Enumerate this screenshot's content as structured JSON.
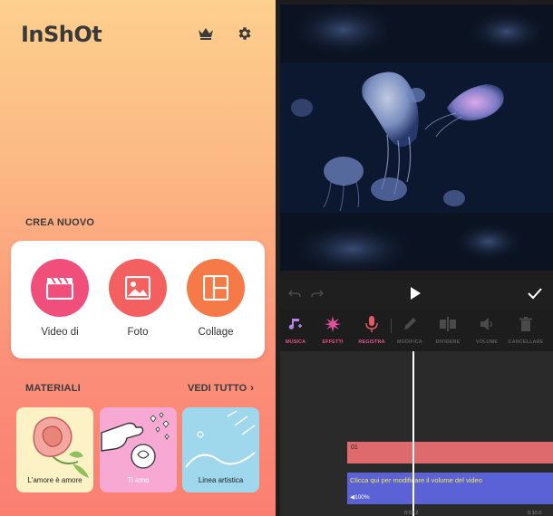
{
  "home": {
    "logo": "InShOt",
    "icons": {
      "premium": "crown-icon",
      "settings": "gear-icon"
    },
    "create_section": {
      "title": "CREA NUOVO",
      "tiles": [
        {
          "label": "Video di",
          "icon": "clapperboard-icon",
          "color": "#f04f7b"
        },
        {
          "label": "Foto",
          "icon": "image-icon",
          "color": "#f3605f"
        },
        {
          "label": "Collage",
          "icon": "collage-icon",
          "color": "#f57a48"
        }
      ]
    },
    "materials_section": {
      "title": "MATERIALI",
      "see_all": "VEDI TUTTO",
      "see_all_icon": "chevron-right-icon",
      "items": [
        {
          "label": "L'amore è amore"
        },
        {
          "label": "Ti amo"
        },
        {
          "label": "Linea artistica"
        }
      ]
    }
  },
  "editor": {
    "controls": {
      "undo": "undo-icon",
      "redo": "redo-icon",
      "play": "play-icon",
      "confirm": "check-icon"
    },
    "tools": [
      {
        "label": "MUSICA",
        "icon": "music-note-icon",
        "active": true
      },
      {
        "label": "EFFETTI",
        "icon": "sparkle-icon",
        "active": true
      },
      {
        "label": "REGISTRA",
        "icon": "microphone-icon",
        "active": true
      },
      {
        "label": "MODIFICA",
        "icon": "pencil-icon",
        "active": false
      },
      {
        "label": "DIVIDERE",
        "icon": "split-icon",
        "active": false
      },
      {
        "label": "VOLUME",
        "icon": "volume-icon",
        "active": false
      },
      {
        "label": "CANCELLARE",
        "icon": "trash-icon",
        "active": false
      }
    ],
    "timeline": {
      "track_label": "01",
      "audio_hint": "Clicca qui per modificare il volume del video",
      "volume": "◀100%",
      "time_current": "0:03.2",
      "time_end": "0:10.0"
    }
  }
}
